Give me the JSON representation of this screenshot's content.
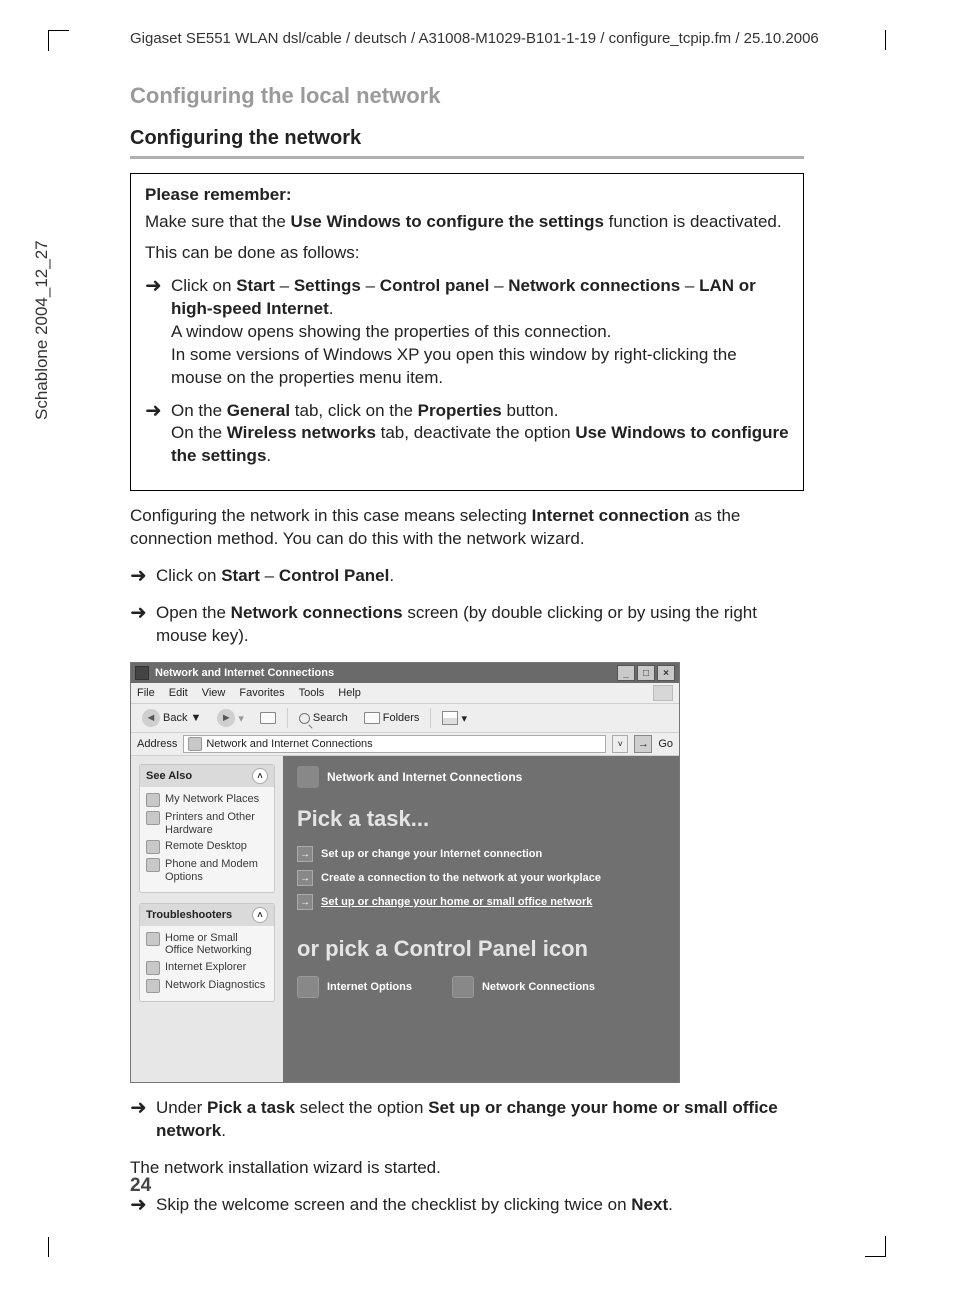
{
  "header_path": "Gigaset SE551 WLAN dsl/cable / deutsch / A31008-M1029-B101-1-19 / configure_tcpip.fm / 25.10.2006",
  "vertical_note": "Schablone 2004_12_27",
  "page_number": "24",
  "section_title": "Configuring the local network",
  "subsection_title": "Configuring the network",
  "box": {
    "title": "Please remember:",
    "intro_pre": "Make sure that the ",
    "intro_bold": "Use Windows to configure the settings",
    "intro_post": " function is deactivated.",
    "line2": "This can be done as follows:",
    "step1": {
      "pre": "Click on ",
      "b1": "Start",
      "d1": " – ",
      "b2": "Settings",
      "d2": " – ",
      "b3": "Control panel",
      "d3": " – ",
      "b4": "Network connections",
      "d4": " – ",
      "b5": "LAN or high-speed Internet",
      "post": ".",
      "p2": "A window opens showing the properties of this connection.",
      "p3": "In some versions of Windows XP you open this window by right-clicking the mouse on the properties menu item."
    },
    "step2": {
      "pre": "On the ",
      "b1": "General",
      "mid1": " tab, click on the ",
      "b2": "Properties",
      "mid2": " button.",
      "l2a": "On the ",
      "l2b": "Wireless networks",
      "l2c": " tab, deactivate the option ",
      "l2d": "Use Windows to configure the settings",
      "l2e": "."
    }
  },
  "para1": {
    "pre": "Configuring the network in this case means selecting ",
    "b": "Internet connection",
    "post": " as the connection method. You can do this with the network wizard."
  },
  "step_a": {
    "pre": "Click on ",
    "b1": "Start",
    "d": " – ",
    "b2": "Control Panel",
    "post": "."
  },
  "step_b": {
    "pre": "Open the ",
    "b": "Network connections",
    "post": " screen (by double clicking or by using the right mouse key)."
  },
  "step_c": {
    "pre": "Under ",
    "b1": "Pick a task",
    "mid": " select the option ",
    "b2": "Set up or change your home or small office network",
    "post": "."
  },
  "para2": "The network installation wizard is started.",
  "step_d": {
    "pre": "Skip the welcome screen and the checklist by clicking twice on ",
    "b": "Next",
    "post": "."
  },
  "shot": {
    "title": "Network and Internet Connections",
    "menu": {
      "file": "File",
      "edit": "Edit",
      "view": "View",
      "favorites": "Favorites",
      "tools": "Tools",
      "help": "Help"
    },
    "toolbar": {
      "back": "Back",
      "search": "Search",
      "folders": "Folders"
    },
    "address_label": "Address",
    "address_value": "Network and Internet Connections",
    "go": "Go",
    "side": {
      "panel1_title": "See Also",
      "p1": {
        "i1": "My Network Places",
        "i2": "Printers and Other Hardware",
        "i3": "Remote Desktop",
        "i4": "Phone and Modem Options"
      },
      "panel2_title": "Troubleshooters",
      "p2": {
        "i1": "Home or Small Office Networking",
        "i2": "Internet Explorer",
        "i3": "Network Diagnostics"
      }
    },
    "main": {
      "header": "Network and Internet Connections",
      "h1": "Pick a task...",
      "t1": "Set up or change your Internet connection",
      "t2": "Create a connection to the network at your workplace",
      "t3": "Set up or change your home or small office network",
      "h2": "or pick a Control Panel icon",
      "c1": "Internet Options",
      "c2": "Network Connections"
    }
  }
}
